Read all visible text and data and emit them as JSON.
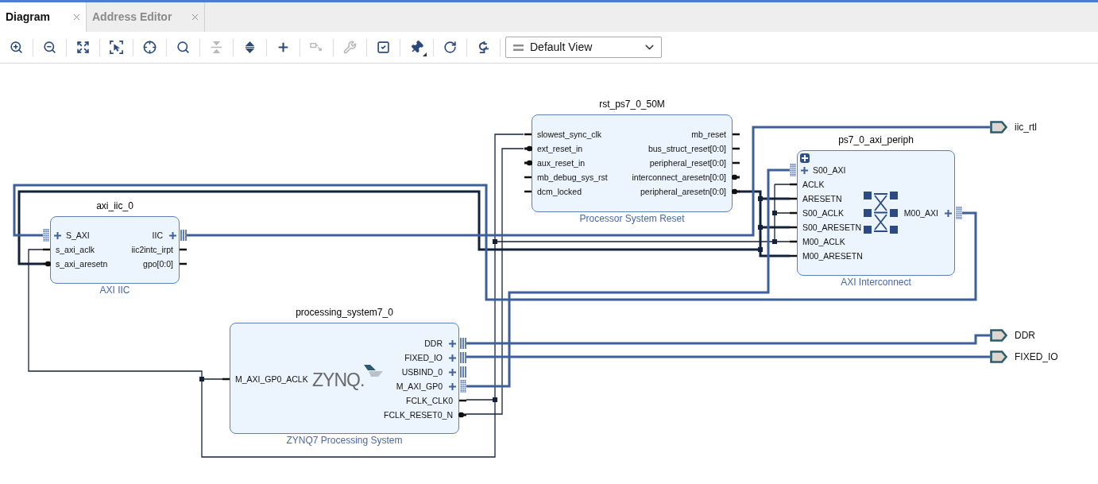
{
  "tabs": [
    {
      "label": "Diagram",
      "selected": true
    },
    {
      "label": "Address Editor",
      "selected": false
    }
  ],
  "toolbar": {
    "buttons": [
      {
        "kind": "zoomin",
        "disabled": false
      },
      {
        "kind": "zoomout",
        "disabled": false
      },
      {
        "kind": "fit",
        "disabled": false
      },
      {
        "kind": "zoomarea",
        "disabled": false
      },
      {
        "kind": "crosshair",
        "disabled": false
      },
      {
        "kind": "search",
        "disabled": false
      },
      {
        "kind": "collapse",
        "disabled": true
      },
      {
        "kind": "expand",
        "disabled": false
      },
      {
        "kind": "add",
        "disabled": false
      },
      {
        "kind": "route",
        "disabled": true
      },
      {
        "kind": "wrench",
        "disabled": true
      },
      {
        "kind": "validate",
        "disabled": false
      },
      {
        "kind": "pin",
        "disabled": false
      },
      {
        "kind": "refresh",
        "disabled": false
      },
      {
        "kind": "regenerate",
        "disabled": false
      }
    ],
    "view": "Default View"
  },
  "diagram": {
    "blocks": [
      {
        "name": "axi_iic_0",
        "type": "AXI IIC",
        "kind": "ip",
        "left_ports": [
          {
            "label": "S_AXI",
            "kind": "interface"
          },
          {
            "label": "s_axi_aclk",
            "kind": "pin"
          },
          {
            "label": "s_axi_aresetn",
            "kind": "inverted"
          }
        ],
        "right_ports": [
          {
            "label": "IIC",
            "kind": "bus"
          },
          {
            "label": "iic2intc_irpt",
            "kind": "pin"
          },
          {
            "label": "gpo[0:0]",
            "kind": "pin"
          }
        ]
      },
      {
        "name": "rst_ps7_0_50M",
        "type": "Processor System Reset",
        "kind": "ip",
        "left_ports": [
          {
            "label": "slowest_sync_clk",
            "kind": "pin"
          },
          {
            "label": "ext_reset_in",
            "kind": "inverted"
          },
          {
            "label": "aux_reset_in",
            "kind": "inverted"
          },
          {
            "label": "mb_debug_sys_rst",
            "kind": "pin"
          },
          {
            "label": "dcm_locked",
            "kind": "pin"
          }
        ],
        "right_ports": [
          {
            "label": "mb_reset",
            "kind": "pin"
          },
          {
            "label": "bus_struct_reset[0:0]",
            "kind": "pin"
          },
          {
            "label": "peripheral_reset[0:0]",
            "kind": "pin"
          },
          {
            "label": "interconnect_aresetn[0:0]",
            "kind": "inverted"
          },
          {
            "label": "peripheral_aresetn[0:0]",
            "kind": "inverted"
          }
        ]
      },
      {
        "name": "ps7_0_axi_periph",
        "type": "AXI Interconnect",
        "kind": "hierarchy",
        "expanded": false,
        "left_ports": [
          {
            "label": "S00_AXI",
            "kind": "interface"
          },
          {
            "label": "ACLK",
            "kind": "pin"
          },
          {
            "label": "ARESETN",
            "kind": "pin"
          },
          {
            "label": "S00_ACLK",
            "kind": "pin"
          },
          {
            "label": "S00_ARESETN",
            "kind": "pin"
          },
          {
            "label": "M00_ACLK",
            "kind": "pin"
          },
          {
            "label": "M00_ARESETN",
            "kind": "pin"
          }
        ],
        "right_ports": [
          {
            "label": "M00_AXI",
            "kind": "interface"
          }
        ]
      },
      {
        "name": "processing_system7_0",
        "type": "ZYNQ7 Processing System",
        "kind": "ip",
        "logo": "ZYNQ.",
        "left_ports": [
          {
            "label": "M_AXI_GP0_ACLK",
            "kind": "pin"
          }
        ],
        "right_ports": [
          {
            "label": "DDR",
            "kind": "bus"
          },
          {
            "label": "FIXED_IO",
            "kind": "bus"
          },
          {
            "label": "USBIND_0",
            "kind": "bus"
          },
          {
            "label": "M_AXI_GP0",
            "kind": "interface"
          },
          {
            "label": "FCLK_CLK0",
            "kind": "pin"
          },
          {
            "label": "FCLK_RESET0_N",
            "kind": "inverted"
          }
        ]
      }
    ],
    "external_ports": [
      {
        "label": "iic_rtl"
      },
      {
        "label": "DDR"
      },
      {
        "label": "FIXED_IO"
      }
    ]
  }
}
